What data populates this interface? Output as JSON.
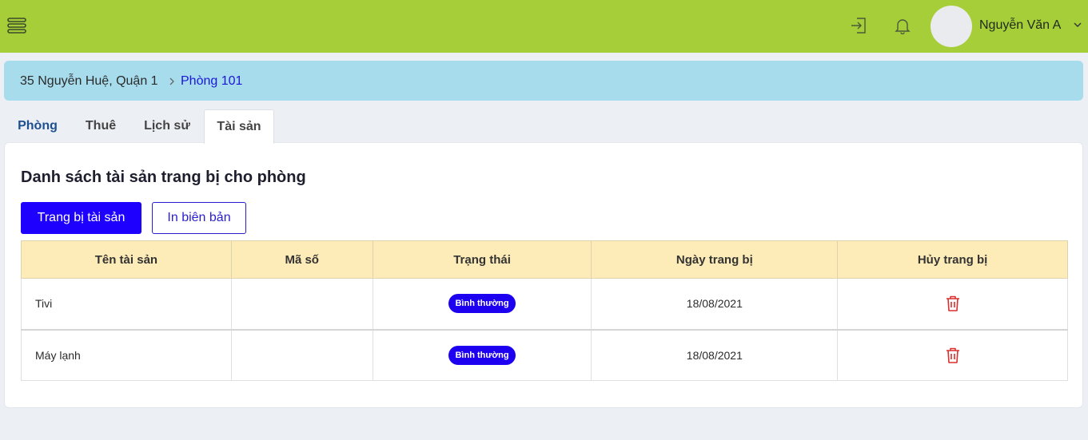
{
  "colors": {
    "topbar": "#a6ce38",
    "accent": "#1e00ff",
    "breadcrumb_bg": "#a7dcec",
    "table_header_bg": "#fdecb8",
    "danger": "#d9302f"
  },
  "header": {
    "menu_icon": "hamburger-icon",
    "login_icon": "sign-in-icon",
    "bell_icon": "bell-icon",
    "user_name": "Nguyễn Văn A"
  },
  "breadcrumb": {
    "items": [
      "35 Nguyễn Huệ, Quận 1",
      "Phòng 101"
    ]
  },
  "tabs": [
    {
      "label": "Phòng",
      "active": false
    },
    {
      "label": "Thuê",
      "active": false
    },
    {
      "label": "Lịch sử",
      "active": false
    },
    {
      "label": "Tài sản",
      "active": true
    }
  ],
  "main": {
    "title": "Danh sách tài sản trang bị cho phòng",
    "primary_button": "Trang bị tài sản",
    "secondary_button": "In biên bản",
    "table": {
      "columns": [
        "Tên tài sản",
        "Mã số",
        "Trạng thái",
        "Ngày trang bị",
        "Hủy trang bị"
      ],
      "rows": [
        {
          "name": "Tivi",
          "code": "",
          "status": "Bình thường",
          "date": "18/08/2021",
          "action_icon": "trash-icon"
        },
        {
          "name": "Máy lạnh",
          "code": "",
          "status": "Bình thường",
          "date": "18/08/2021",
          "action_icon": "trash-icon"
        }
      ]
    }
  }
}
